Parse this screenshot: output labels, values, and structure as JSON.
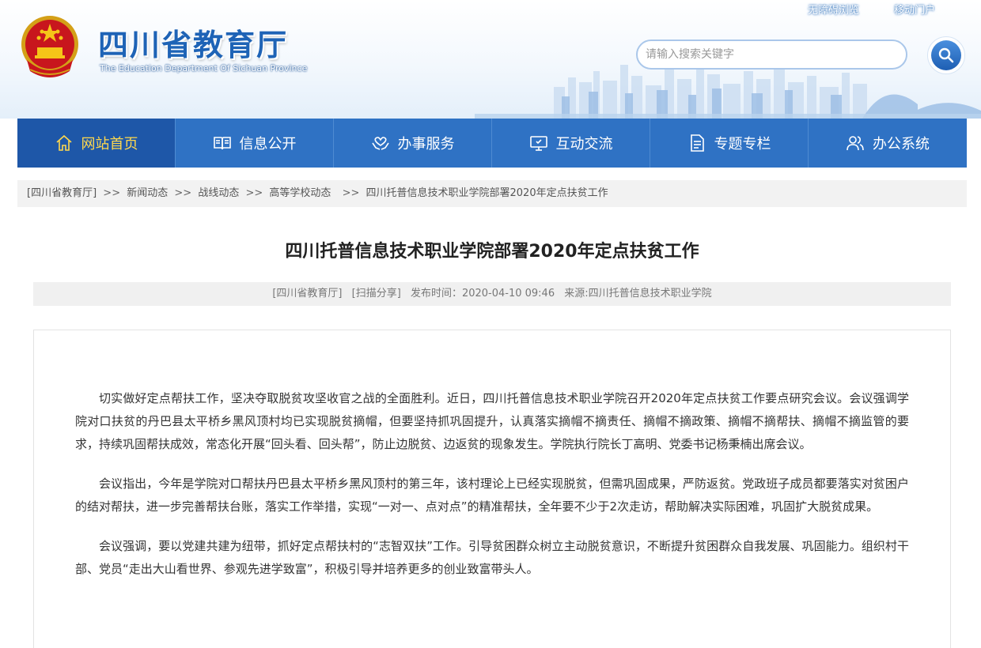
{
  "header": {
    "title": "四川省教育厅",
    "subtitle": "The Education Department Of Sichuan Province",
    "top_links": [
      "无障碍浏览",
      "移动门户"
    ],
    "search_placeholder": "请输入搜索关键字"
  },
  "nav": {
    "items": [
      {
        "label": "网站首页",
        "icon": "home-icon",
        "active": true
      },
      {
        "label": "信息公开",
        "icon": "book-icon",
        "active": false
      },
      {
        "label": "办事服务",
        "icon": "hands-icon",
        "active": false
      },
      {
        "label": "互动交流",
        "icon": "monitor-icon",
        "active": false
      },
      {
        "label": "专题专栏",
        "icon": "document-icon",
        "active": false
      },
      {
        "label": "办公系统",
        "icon": "users-icon",
        "active": false
      }
    ]
  },
  "breadcrumb": {
    "items": [
      "[四川省教育厅]",
      "新闻动态",
      "战线动态",
      "高等学校动态",
      "四川托普信息技术职业学院部署2020年定点扶贫工作"
    ],
    "separator": ">>"
  },
  "article": {
    "title": "四川托普信息技术职业学院部署2020年定点扶贫工作",
    "meta": {
      "site": "[四川省教育厅]",
      "share": "[扫描分享]",
      "published": "发布时间：2020-04-10 09:46",
      "source": "来源:四川托普信息技术职业学院"
    },
    "paragraphs": [
      "切实做好定点帮扶工作，坚决夺取脱贫攻坚收官之战的全面胜利。近日，四川托普信息技术职业学院召开2020年定点扶贫工作要点研究会议。会议强调学院对口扶贫的丹巴县太平桥乡黑风顶村均已实现脱贫摘帽，但要坚持抓巩固提升，认真落实摘帽不摘责任、摘帽不摘政策、摘帽不摘帮扶、摘帽不摘监管的要求，持续巩固帮扶成效，常态化开展“回头看、回头帮”，防止边脱贫、边返贫的现象发生。学院执行院长丁高明、党委书记杨秉楠出席会议。",
      "会议指出，今年是学院对口帮扶丹巴县太平桥乡黑风顶村的第三年，该村理论上已经实现脱贫，但需巩固成果，严防返贫。党政班子成员都要落实对贫困户的结对帮扶，进一步完善帮扶台账，落实工作举措，实现“一对一、点对点”的精准帮扶，全年要不少于2次走访，帮助解决实际困难，巩固扩大脱贫成果。",
      "会议强调，要以党建共建为纽带，抓好定点帮扶村的“志智双扶”工作。引导贫困群众树立主动脱贫意识，不断提升贫困群众自我发展、巩固能力。组织村干部、党员“走出大山看世界、参观先进学致富”，积极引导并培养更多的创业致富带头人。"
    ]
  },
  "colors": {
    "nav_bg": "#2f72c4",
    "nav_active_bg": "#1e57a8",
    "nav_active_text": "#ffd84d",
    "title_blue": "#1e63b6"
  }
}
